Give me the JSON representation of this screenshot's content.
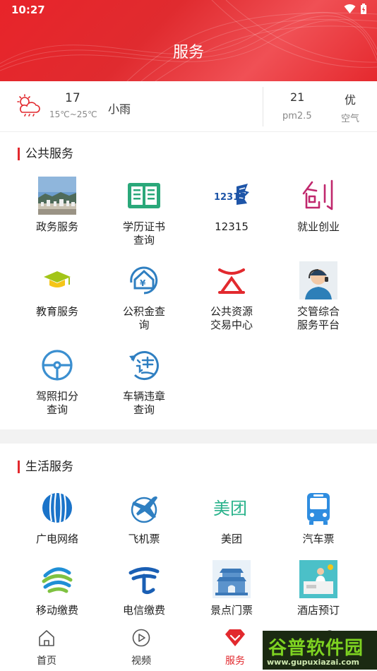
{
  "status": {
    "time": "10:27"
  },
  "header": {
    "title": "服务"
  },
  "weather": {
    "temperature": "17",
    "range": "15℃~25℃",
    "condition": "小雨",
    "aqi_value": "21",
    "aqi_label": "pm2.5",
    "quality": "优",
    "quality_label": "空气"
  },
  "public_services": {
    "title": "公共服务",
    "items": [
      {
        "line1": "政务服务",
        "line2": "",
        "icon": "city-photo-icon"
      },
      {
        "line1": "学历证书",
        "line2": "查询",
        "icon": "certificate-book-icon"
      },
      {
        "line1": "12315",
        "line2": "",
        "icon": "consumer-hotline-12315-icon"
      },
      {
        "line1": "就业创业",
        "line2": "",
        "icon": "chuang-character-icon"
      },
      {
        "line1": "教育服务",
        "line2": "",
        "icon": "graduation-cap-icon"
      },
      {
        "line1": "公积金查",
        "line2": "询",
        "icon": "housing-fund-icon"
      },
      {
        "line1": "公共资源",
        "line2": "交易中心",
        "icon": "trading-center-logo-icon"
      },
      {
        "line1": "交管综合",
        "line2": "服务平台",
        "icon": "traffic-officer-icon"
      },
      {
        "line1": "驾照扣分",
        "line2": "查询",
        "icon": "steering-wheel-icon"
      },
      {
        "line1": "车辆违章",
        "line2": "查询",
        "icon": "violation-icon"
      }
    ]
  },
  "life_services": {
    "title": "生活服务",
    "items": [
      {
        "line1": "广电网络",
        "line2": "",
        "icon": "broadcast-network-icon"
      },
      {
        "line1": "飞机票",
        "line2": "",
        "icon": "airplane-icon"
      },
      {
        "line1": "美团",
        "line2": "",
        "icon": "meituan-logo-icon",
        "logo_text": "美团"
      },
      {
        "line1": "汽车票",
        "line2": "",
        "icon": "bus-icon"
      },
      {
        "line1": "移动缴费",
        "line2": "",
        "icon": "china-mobile-icon"
      },
      {
        "line1": "电信缴费",
        "line2": "",
        "icon": "china-telecom-icon"
      },
      {
        "line1": "景点门票",
        "line2": "",
        "icon": "scenic-gate-icon"
      },
      {
        "line1": "酒店预订",
        "line2": "",
        "icon": "hotel-reception-icon"
      }
    ]
  },
  "nav": {
    "items": [
      {
        "label": "首页",
        "icon": "home-icon"
      },
      {
        "label": "视频",
        "icon": "play-icon"
      },
      {
        "label": "服务",
        "icon": "gem-icon"
      },
      {
        "label": "",
        "icon": ""
      }
    ]
  },
  "watermark": {
    "text": "谷普软件园",
    "url": "www.gupuxiazai.com"
  },
  "colors": {
    "brand_red": "#e2292e",
    "watermark_green": "#7ed321"
  }
}
